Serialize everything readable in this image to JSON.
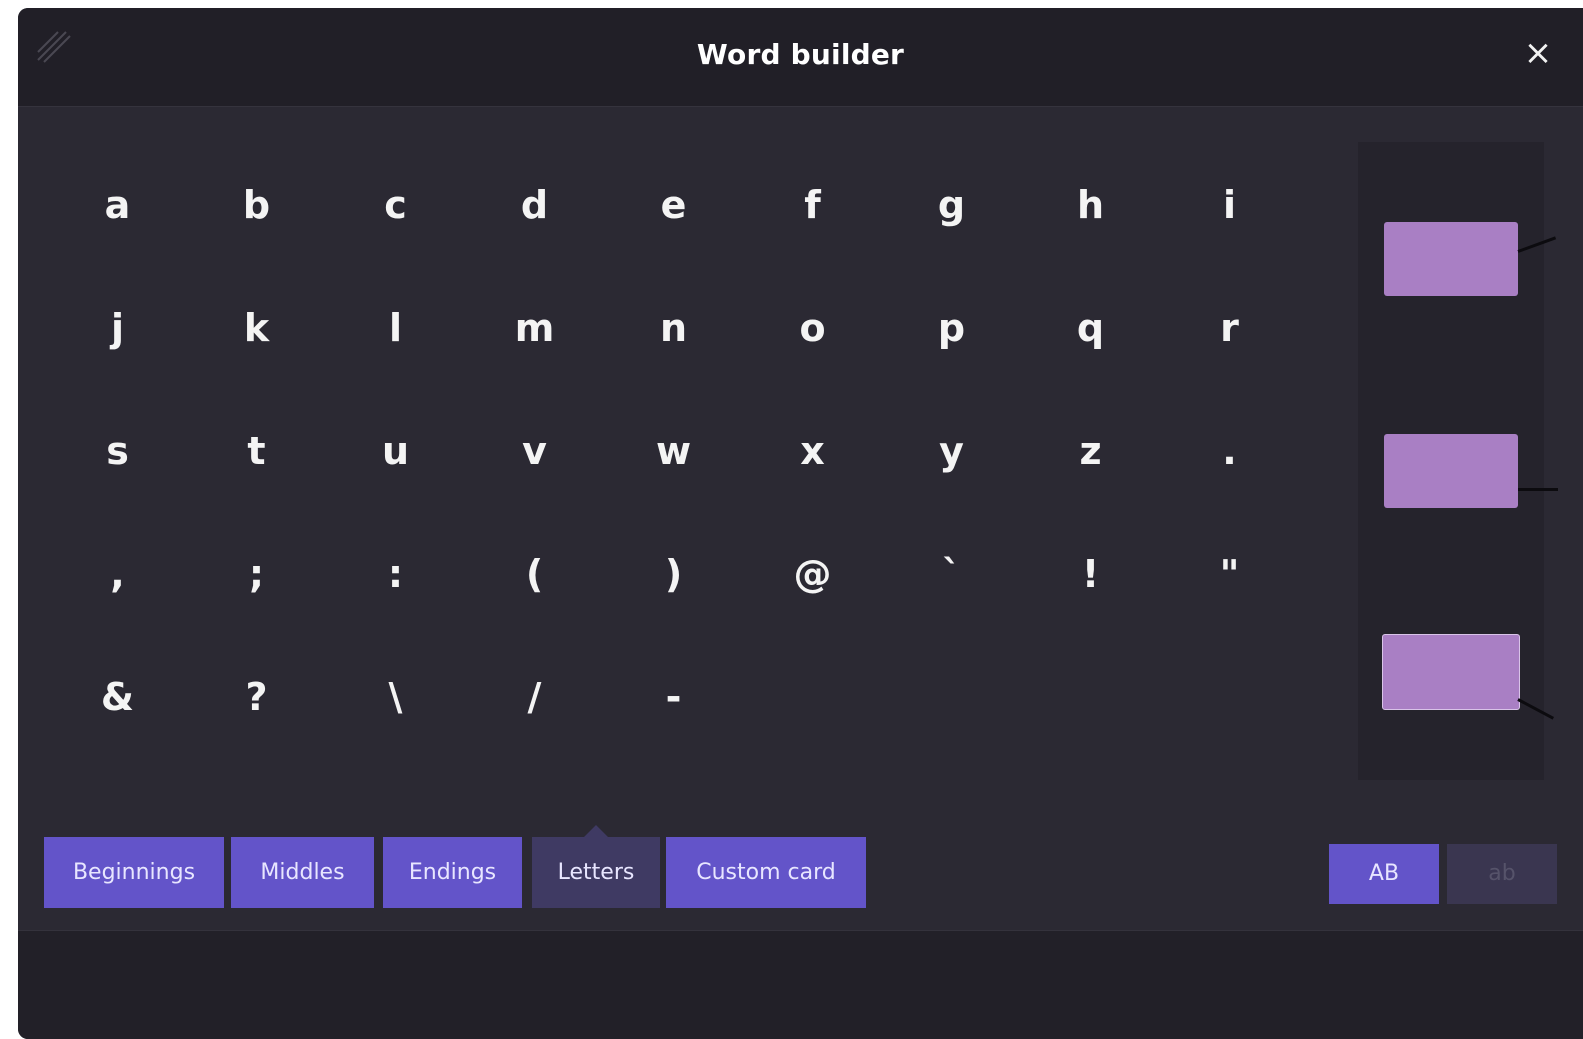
{
  "window": {
    "title": "Word builder",
    "close_symbol": "×"
  },
  "keys": [
    [
      "a",
      "b",
      "c",
      "d",
      "e",
      "f",
      "g",
      "h",
      "i"
    ],
    [
      "j",
      "k",
      "l",
      "m",
      "n",
      "o",
      "p",
      "q",
      "r"
    ],
    [
      "s",
      "t",
      "u",
      "v",
      "w",
      "x",
      "y",
      "z",
      "."
    ],
    [
      ",",
      ";",
      ":",
      "(",
      ")",
      "@",
      "`",
      "!",
      "\""
    ],
    [
      "&",
      "?",
      "\\",
      "/",
      "-"
    ]
  ],
  "tabs": [
    {
      "label": "Beginnings",
      "active": false
    },
    {
      "label": "Middles",
      "active": false
    },
    {
      "label": "Endings",
      "active": false
    },
    {
      "label": "Letters",
      "active": true
    },
    {
      "label": "Custom card",
      "active": false
    }
  ],
  "case_toggle": {
    "upper_label": "AB",
    "lower_label": "ab",
    "selected": "AB"
  },
  "preview": {
    "card_count": 3
  },
  "colors": {
    "window_bg": "#2b2933",
    "titlebar_bg": "#211f27",
    "tab_bg": "#6354c9",
    "tab_active_bg": "#3f3a63",
    "card_fill": "#a97fc4",
    "text": "#f4f4f4"
  },
  "icons": {
    "grip": "grip-icon",
    "close": "close-icon"
  }
}
